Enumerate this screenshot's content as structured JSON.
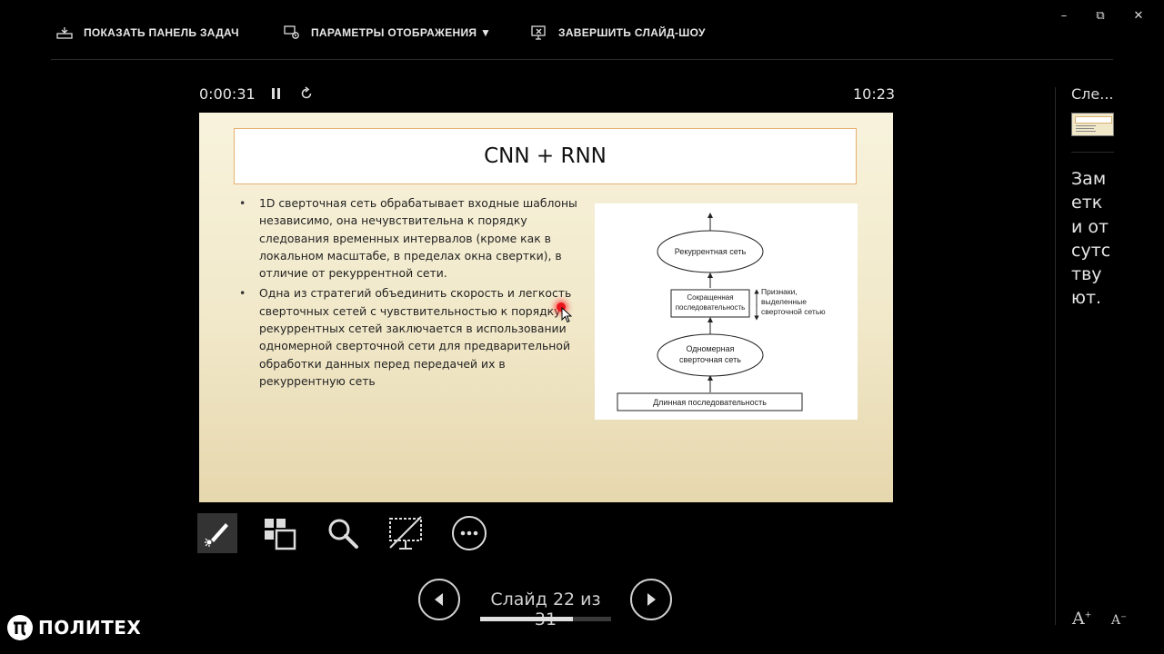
{
  "toolbar": {
    "taskbar_label": "ПОКАЗАТЬ ПАНЕЛЬ ЗАДАЧ",
    "display_settings_label": "ПАРАМЕТРЫ ОТОБРАЖЕНИЯ ▼",
    "end_show_label": "ЗАВЕРШИТЬ СЛАЙД-ШОУ",
    "icons": [
      "taskbar-icon",
      "display-settings-icon",
      "end-slideshow-icon"
    ]
  },
  "window_controls": {
    "minimize": "–",
    "restore": "⧉",
    "close": "✕"
  },
  "presenter": {
    "elapsed_time": "0:00:31",
    "clock": "10:23",
    "pause_icon": "pause-icon",
    "reset_icon": "reset-timer-icon"
  },
  "slide": {
    "title": "CNN + RNN",
    "bullets": [
      "1D сверточная сеть обрабатывает входные шаблоны независимо, она нечувствительна к порядку следования временных интервалов (кроме как в локальном масштабе, в пределах окна свертки), в отличие от рекуррентной сети.",
      "Одна из стратегий объединить скорость и легкость сверточных сетей с чувствительностью к порядку рекуррентных сетей заключается в использовании одномерной сверточной сети для предварительной обработки данных перед передачей их в рекуррентную сеть"
    ],
    "diagram": {
      "recurrent": "Рекуррентная сеть",
      "short_seq": "Сокращенная последовательность",
      "features": "Признаки, выделенные сверточной сетью",
      "conv1d": "Одномерная сверточная сеть",
      "long_seq": "Длинная последовательность"
    }
  },
  "tools": {
    "pen": "pen-laser-icon",
    "all_slides": "see-all-slides-icon",
    "zoom": "zoom-icon",
    "black_screen": "black-screen-icon",
    "more": "more-options-icon"
  },
  "navigation": {
    "counter": "Слайд 22 из 31",
    "current": 22,
    "total": 31,
    "progress": 0.71
  },
  "sidebar": {
    "next_label": "Сле...",
    "notes": "Заметки отсутствуют."
  },
  "logo": {
    "text": "ПОЛИТЕХ"
  },
  "colors": {
    "background": "#000000",
    "slide_title_border": "#e6b070",
    "laser": "#e8151c"
  }
}
